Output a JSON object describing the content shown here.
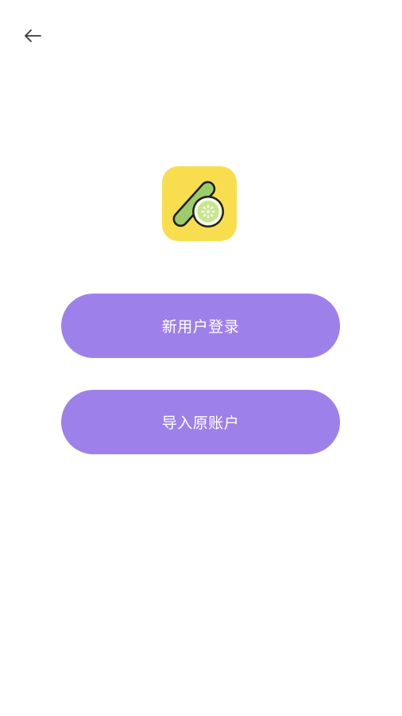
{
  "header": {
    "back_icon": "arrow-left-icon"
  },
  "logo": {
    "icon": "cucumber-logo-icon",
    "background_color": "#F8DE4E"
  },
  "actions": {
    "new_user_login_label": "新用户登录",
    "import_account_label": "导入原账户",
    "button_color": "#9E80EA"
  }
}
